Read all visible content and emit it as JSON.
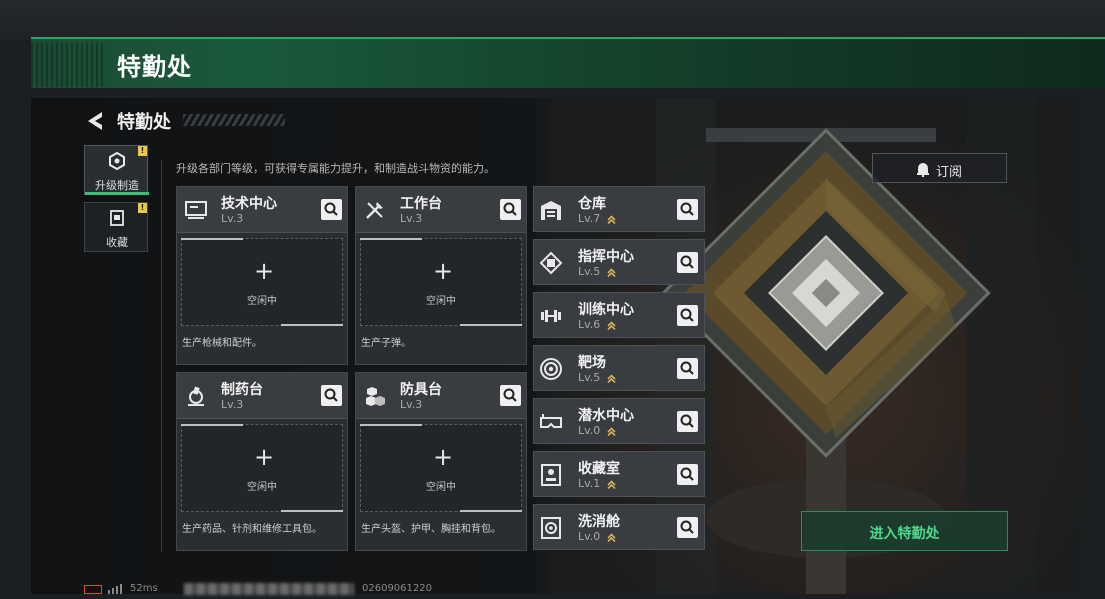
{
  "header": {
    "title": "特勤处"
  },
  "page": {
    "title": "特勤处",
    "description": "升级各部门等级，可获得专属能力提升，和制造战斗物资的能力。"
  },
  "tabs": [
    {
      "label": "升级制造",
      "badge": "!",
      "active": true,
      "icon": "upgrade-build-icon"
    },
    {
      "label": "收藏",
      "badge": "!",
      "active": false,
      "icon": "collection-icon"
    }
  ],
  "subscribe": {
    "label": "订阅",
    "icon": "subscribe-icon"
  },
  "workstations": [
    {
      "name": "技术中心",
      "level": "Lv.3",
      "icon": "computer-icon",
      "slot_plus": "+",
      "slot_status": "空闲中",
      "desc": "生产枪械和配件。"
    },
    {
      "name": "工作台",
      "level": "Lv.3",
      "icon": "tools-icon",
      "slot_plus": "+",
      "slot_status": "空闲中",
      "desc": "生产子弹。"
    },
    {
      "name": "制药台",
      "level": "Lv.3",
      "icon": "microscope-icon",
      "slot_plus": "+",
      "slot_status": "空闲中",
      "desc": "生产药品、针剂和维修工具包。"
    },
    {
      "name": "防具台",
      "level": "Lv.3",
      "icon": "armor-boxes-icon",
      "slot_plus": "+",
      "slot_status": "空闲中",
      "desc": "生产头盔、护甲、胸挂和背包。"
    }
  ],
  "facilities": [
    {
      "name": "仓库",
      "level": "Lv.7",
      "icon": "warehouse-icon",
      "upgradable": true
    },
    {
      "name": "指挥中心",
      "level": "Lv.5",
      "icon": "command-chip-icon",
      "upgradable": true
    },
    {
      "name": "训练中心",
      "level": "Lv.6",
      "icon": "dumbbell-icon",
      "upgradable": true
    },
    {
      "name": "靶场",
      "level": "Lv.5",
      "icon": "target-icon",
      "upgradable": true
    },
    {
      "name": "潜水中心",
      "level": "Lv.0",
      "icon": "diving-goggles-icon",
      "upgradable": true
    },
    {
      "name": "收藏室",
      "level": "Lv.1",
      "icon": "display-case-icon",
      "upgradable": true
    },
    {
      "name": "洗消舱",
      "level": "Lv.0",
      "icon": "hazard-chamber-icon",
      "upgradable": true
    }
  ],
  "enter_button": {
    "label": "进入特勤处"
  },
  "status_bar": {
    "ping": "52ms",
    "uid": "02609061220"
  },
  "colors": {
    "accent_green": "#37c07a",
    "title_green": "#1a5a3a",
    "badge_yellow": "#e8c84a",
    "upgrade_arrow": "#d8b35a",
    "battery_red": "#e04545"
  }
}
